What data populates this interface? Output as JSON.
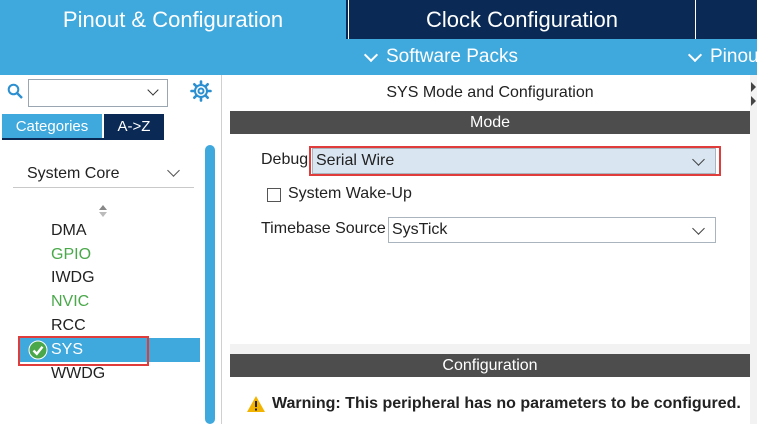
{
  "tabs": {
    "pinout": "Pinout & Configuration",
    "clock": "Clock Configuration"
  },
  "subbar": {
    "software_packs": "Software Packs",
    "pinout": "Pinout"
  },
  "left": {
    "search": {
      "value": "",
      "placeholder": ""
    },
    "cat_tabs": [
      "Categories",
      "A->Z"
    ],
    "group": "System Core",
    "items": [
      {
        "label": "DMA",
        "state": "normal"
      },
      {
        "label": "GPIO",
        "state": "green"
      },
      {
        "label": "IWDG",
        "state": "normal"
      },
      {
        "label": "NVIC",
        "state": "green"
      },
      {
        "label": "RCC",
        "state": "normal"
      },
      {
        "label": "SYS",
        "state": "selected"
      },
      {
        "label": "WWDG",
        "state": "normal"
      }
    ]
  },
  "right": {
    "title": "SYS Mode and Configuration",
    "mode_header": "Mode",
    "debug": {
      "label": "Debug",
      "value": "Serial Wire"
    },
    "wakeup": {
      "label": "System Wake-Up",
      "checked": false
    },
    "timebase": {
      "label": "Timebase Source",
      "value": "SysTick"
    },
    "config_header": "Configuration",
    "warning": "Warning: This peripheral has no parameters to be configured."
  },
  "colors": {
    "accent": "#3fa8dd",
    "navy": "#0a2a55",
    "green": "#4aa84a",
    "highlight": "#e03c3c",
    "section_header": "#4d4d4d"
  }
}
